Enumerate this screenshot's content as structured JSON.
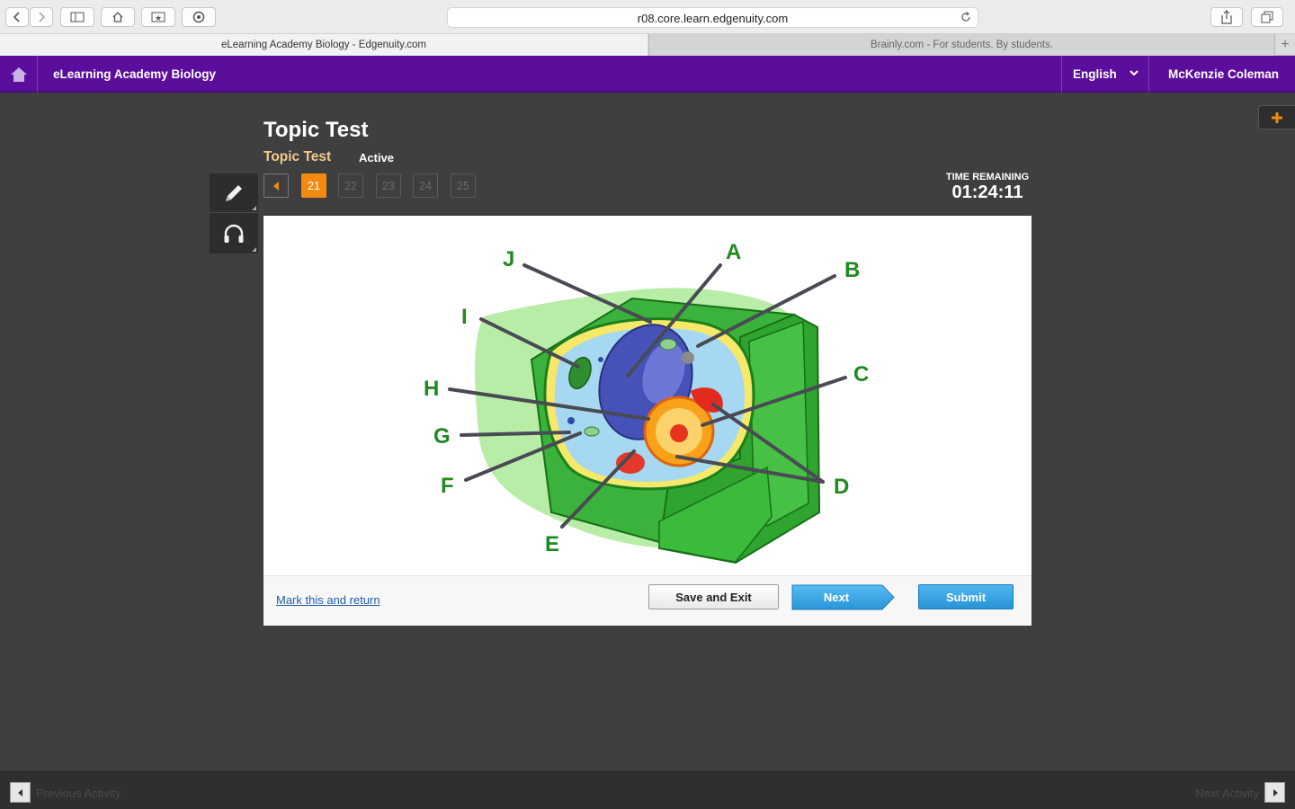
{
  "browser": {
    "url": "r08.core.learn.edgenuity.com",
    "tabs": [
      {
        "title": "eLearning Academy Biology - Edgenuity.com",
        "active": true
      },
      {
        "title": "Brainly.com - For students. By students.",
        "active": false
      }
    ],
    "new_tab_symbol": "+"
  },
  "header": {
    "course_title": "eLearning Academy Biology",
    "language": "English",
    "user_name": "McKenzie Coleman",
    "brand_color": "#5b0e9c"
  },
  "activity": {
    "title": "Topic Test",
    "subtitle": "Topic Test",
    "status": "Active",
    "question_numbers": [
      "21",
      "22",
      "23",
      "24",
      "25"
    ],
    "current_question": "21",
    "time_label": "TIME REMAINING",
    "time_remaining": "01:24:11"
  },
  "diagram": {
    "labels": [
      "A",
      "B",
      "C",
      "D",
      "E",
      "F",
      "G",
      "H",
      "I",
      "J"
    ]
  },
  "footer": {
    "mark_link": "Mark this and return",
    "save_label": "Save and Exit",
    "next_label": "Next",
    "submit_label": "Submit"
  },
  "bottom": {
    "previous_activity": "Previous Activity",
    "next_activity": "Next Activity"
  },
  "icons": {
    "home": "home-icon",
    "pencil": "pencil-icon",
    "audio": "headphones-icon",
    "plus": "plus-icon"
  }
}
